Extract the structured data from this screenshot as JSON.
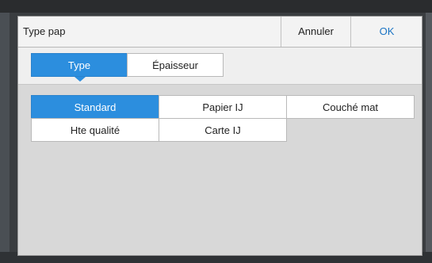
{
  "dialog": {
    "title": "Type pap",
    "cancel_label": "Annuler",
    "ok_label": "OK"
  },
  "tabs": [
    {
      "label": "Type",
      "selected": true
    },
    {
      "label": "Épaisseur",
      "selected": false
    }
  ],
  "paper_types": [
    {
      "label": "Standard",
      "selected": true
    },
    {
      "label": "Papier IJ",
      "selected": false
    },
    {
      "label": "Couché mat",
      "selected": false
    },
    {
      "label": "Hte qualité",
      "selected": false
    },
    {
      "label": "Carte IJ",
      "selected": false
    }
  ],
  "colors": {
    "accent": "#2c8ede",
    "ok_text": "#1b74c4",
    "dialog_body": "#d8d8d8"
  }
}
